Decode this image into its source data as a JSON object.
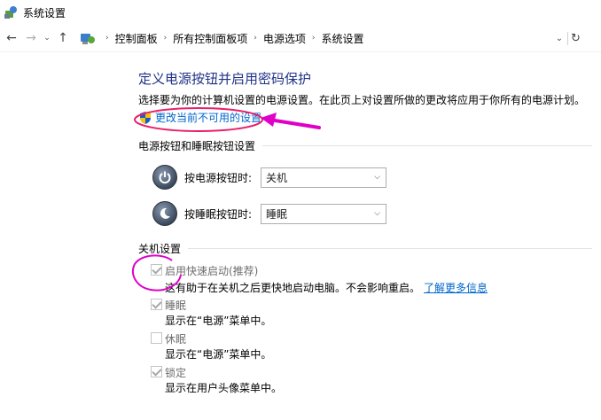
{
  "window": {
    "title": "系统设置"
  },
  "breadcrumb": [
    "控制面板",
    "所有控制面板项",
    "电源选项",
    "系统设置"
  ],
  "page": {
    "title": "定义电源按钮并启用密码保护",
    "description": "选择要为你的计算机设置的电源设置。在此页上对设置所做的更改将应用于你所有的电源计划。",
    "change_link": "更改当前不可用的设置"
  },
  "buttons_section": {
    "heading": "电源按钮和睡眠按钮设置",
    "rows": [
      {
        "label": "按电源按钮时:",
        "value": "关机",
        "icon": "power-icon"
      },
      {
        "label": "按睡眠按钮时:",
        "value": "睡眠",
        "icon": "sleep-icon"
      }
    ]
  },
  "shutdown_section": {
    "heading": "关机设置",
    "items": [
      {
        "label": "启用快速启动(推荐)",
        "checked": true,
        "desc": "这有助于在关机之后更快地启动电脑。不会影响重启。",
        "link": "了解更多信息"
      },
      {
        "label": "睡眠",
        "checked": true,
        "desc": "显示在“电源”菜单中。"
      },
      {
        "label": "休眠",
        "checked": false,
        "desc": "显示在“电源”菜单中。"
      },
      {
        "label": "锁定",
        "checked": true,
        "desc": "显示在用户头像菜单中。"
      }
    ]
  },
  "colors": {
    "title": "#1e3287",
    "link": "#0066cc",
    "annotation": "#e000c8"
  }
}
